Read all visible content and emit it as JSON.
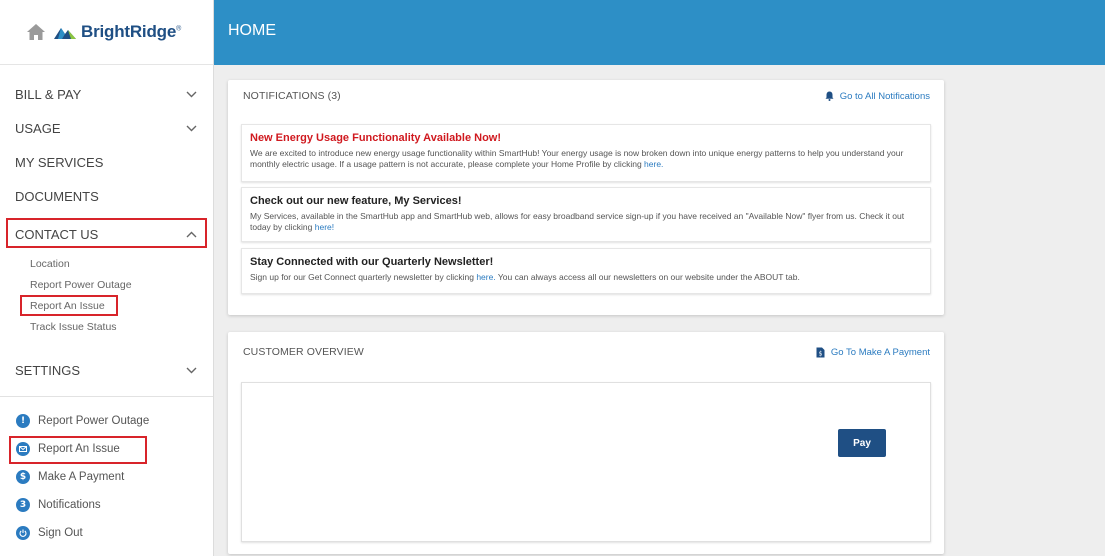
{
  "brand": {
    "name": "BrightRidge",
    "registered": "®"
  },
  "topbar": {
    "title": "HOME"
  },
  "colors": {
    "primary": "#2d8fc6",
    "brand_navy": "#1f4f84",
    "highlight": "#d8242a",
    "link": "#2b7bc0",
    "alert_red": "#d0191f"
  },
  "sidebar": {
    "nav": [
      {
        "label": "BILL & PAY",
        "icon": "chevron-down-icon"
      },
      {
        "label": "USAGE",
        "icon": "chevron-down-icon"
      },
      {
        "label": "MY SERVICES"
      },
      {
        "label": "DOCUMENTS"
      },
      {
        "label": "CONTACT US",
        "icon": "chevron-up-icon"
      }
    ],
    "contact_sub": [
      "Location",
      "Report Power Outage",
      "Report An Issue",
      "Track Issue Status"
    ],
    "settings": {
      "label": "SETTINGS",
      "icon": "chevron-down-icon"
    },
    "quick_links": [
      {
        "label": "Report Power Outage",
        "icon": "exclamation-icon"
      },
      {
        "label": "Report An Issue",
        "icon": "envelope-icon"
      },
      {
        "label": "Make A Payment",
        "icon": "dollar-icon"
      },
      {
        "label": "Notifications",
        "icon": "notification-count-icon",
        "badge": "3"
      },
      {
        "label": "Sign Out",
        "icon": "power-icon"
      }
    ]
  },
  "notifications_card": {
    "title": "NOTIFICATIONS (3)",
    "link": "Go to All Notifications",
    "items": [
      {
        "title": "New Energy Usage Functionality Available Now!",
        "body": "We are excited to introduce new energy usage functionality within SmartHub! Your energy usage is now broken down into unique energy patterns to help you understand your monthly electric usage. If a usage pattern is not accurate, please complete your Home Profile by clicking",
        "link": "here."
      },
      {
        "title": "Check out our new feature, My Services!",
        "body": "My Services, available in the SmartHub app and SmartHub web, allows for easy broadband service sign-up if you have received an \"Available Now\" flyer from us. Check it out today by clicking",
        "link": "here!"
      },
      {
        "title": "Stay Connected with our Quarterly Newsletter!",
        "body_before": "Sign up for our Get Connect quarterly newsletter by clicking",
        "link": "here.",
        "body_after": "You can always access all our newsletters on our website under the ABOUT tab."
      }
    ]
  },
  "customer_card": {
    "title": "CUSTOMER OVERVIEW",
    "link": "Go To Make A Payment",
    "pay_button": "Pay"
  }
}
